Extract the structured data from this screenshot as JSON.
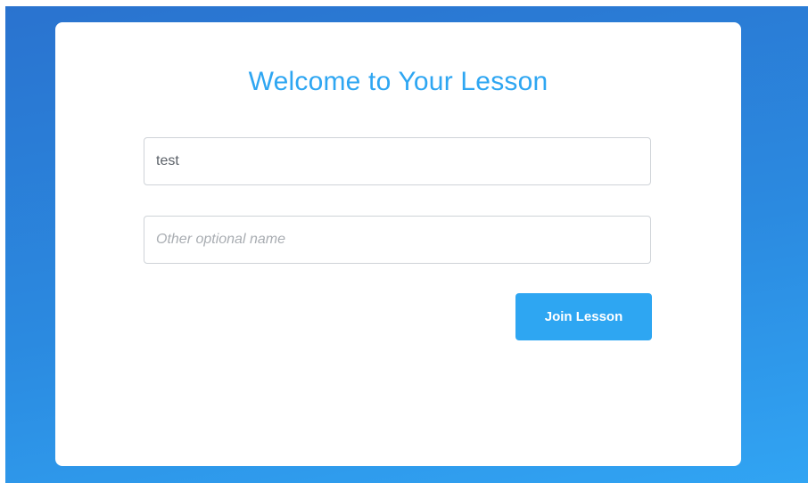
{
  "login_card": {
    "title": "Welcome to Your Lesson",
    "name_field": {
      "value": "test",
      "placeholder": ""
    },
    "other_name_field": {
      "value": "",
      "placeholder": "Other optional name"
    },
    "join_button_label": "Join Lesson"
  },
  "colors": {
    "accent": "#2ea6f2",
    "background_top": "#2a73cf",
    "background_bottom": "#31a4f3",
    "card": "#ffffff"
  }
}
